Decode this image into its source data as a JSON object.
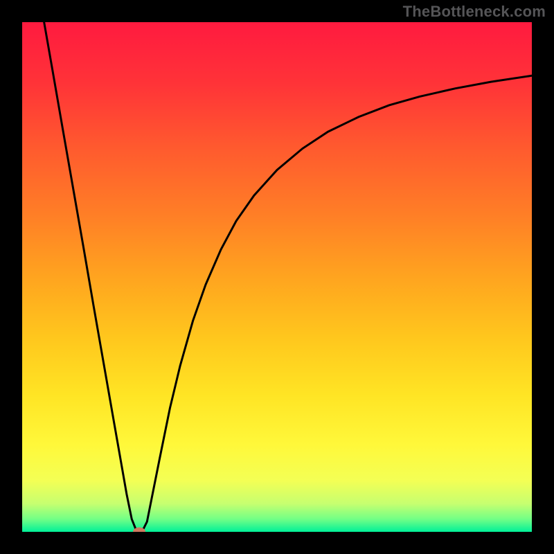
{
  "watermark": "TheBottleneck.com",
  "chart_data": {
    "type": "line",
    "title": "",
    "xlabel": "",
    "ylabel": "",
    "xlim": [
      0,
      100
    ],
    "ylim": [
      0,
      100
    ],
    "background_gradient": {
      "direction": "vertical",
      "stops": [
        {
          "offset": 0.0,
          "color": "#ff1a3f"
        },
        {
          "offset": 0.12,
          "color": "#ff3338"
        },
        {
          "offset": 0.25,
          "color": "#ff5b2e"
        },
        {
          "offset": 0.38,
          "color": "#ff7f26"
        },
        {
          "offset": 0.5,
          "color": "#ffa41f"
        },
        {
          "offset": 0.62,
          "color": "#ffc71d"
        },
        {
          "offset": 0.73,
          "color": "#ffe424"
        },
        {
          "offset": 0.83,
          "color": "#fff83a"
        },
        {
          "offset": 0.9,
          "color": "#f3ff55"
        },
        {
          "offset": 0.945,
          "color": "#c6ff70"
        },
        {
          "offset": 0.975,
          "color": "#72ff86"
        },
        {
          "offset": 1.0,
          "color": "#00f098"
        }
      ]
    },
    "series": [
      {
        "name": "bottleneck-curve",
        "color": "#000000",
        "stroke_width": 3,
        "x": [
          4.3,
          6,
          8,
          10,
          12,
          14,
          16,
          18,
          19.5,
          20.5,
          21.5,
          22.5,
          23.5,
          24.5,
          25.5,
          27,
          29,
          31,
          33.5,
          36,
          39,
          42,
          45.5,
          50,
          55,
          60,
          66,
          72,
          78,
          85,
          92,
          100
        ],
        "y": [
          100,
          90.3,
          78.8,
          67.4,
          56.0,
          44.4,
          33.0,
          21.6,
          13.1,
          7.4,
          2.5,
          0,
          0,
          2.0,
          7.0,
          14.5,
          24.3,
          32.6,
          41.4,
          48.5,
          55.4,
          61.0,
          66.0,
          71.0,
          75.2,
          78.5,
          81.4,
          83.7,
          85.4,
          87.0,
          88.3,
          89.5
        ]
      }
    ],
    "marker": {
      "x": 23.0,
      "y": 0.0,
      "color": "#cf7a60"
    },
    "axes_visible": false,
    "grid": false
  }
}
